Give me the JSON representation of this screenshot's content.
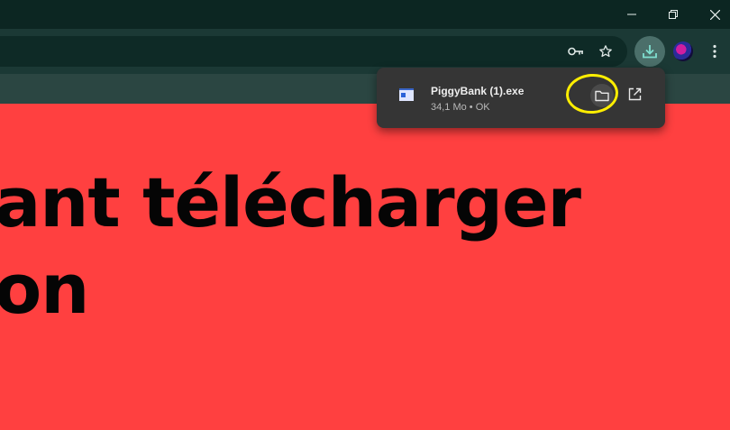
{
  "window": {
    "minimize_icon": "minimize-icon",
    "restore_icon": "restore-icon",
    "close_icon": "close-icon"
  },
  "toolbar": {
    "password_icon": "key-icon",
    "bookmark_icon": "star-icon",
    "download_icon": "download-icon",
    "menu_icon": "more-vert-icon"
  },
  "page": {
    "heading_line1": "ant télécharger",
    "heading_line2": "on",
    "background_color": "#ff4040"
  },
  "download": {
    "file_name": "PiggyBank (1).exe",
    "status": "34,1 Mo • OK",
    "folder_icon": "folder-icon",
    "open_icon": "open-external-icon",
    "highlight_color": "#ffee00"
  }
}
